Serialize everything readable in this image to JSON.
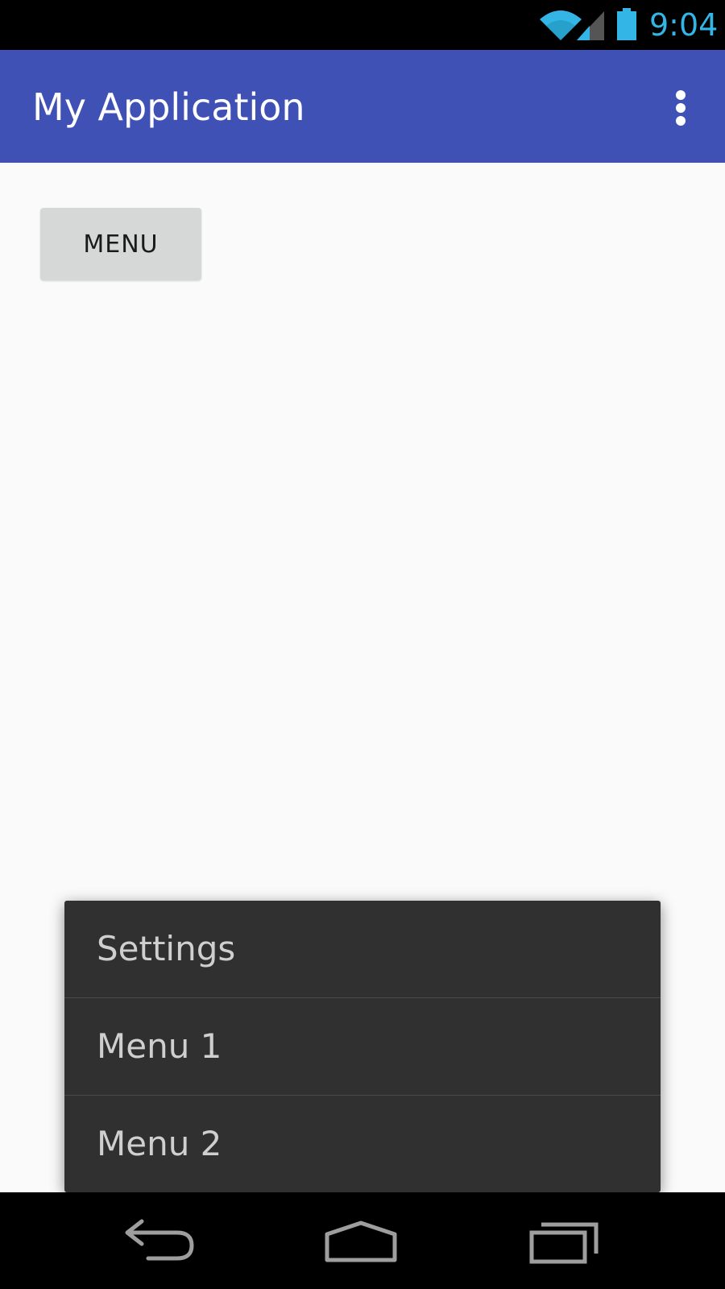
{
  "status_bar": {
    "time": "9:04",
    "icons": [
      "wifi-icon",
      "signal-icon",
      "battery-icon"
    ],
    "accent_color": "#33b5e5"
  },
  "app_bar": {
    "title": "My Application",
    "color": "#3f51b5",
    "overflow_icon": "more-vert-icon"
  },
  "content": {
    "menu_button_label": "MENU"
  },
  "popup_menu": {
    "items": [
      {
        "label": "Settings"
      },
      {
        "label": "Menu 1"
      },
      {
        "label": "Menu 2"
      }
    ]
  },
  "nav_bar": {
    "icons": [
      "back-icon",
      "home-icon",
      "recents-icon"
    ]
  }
}
